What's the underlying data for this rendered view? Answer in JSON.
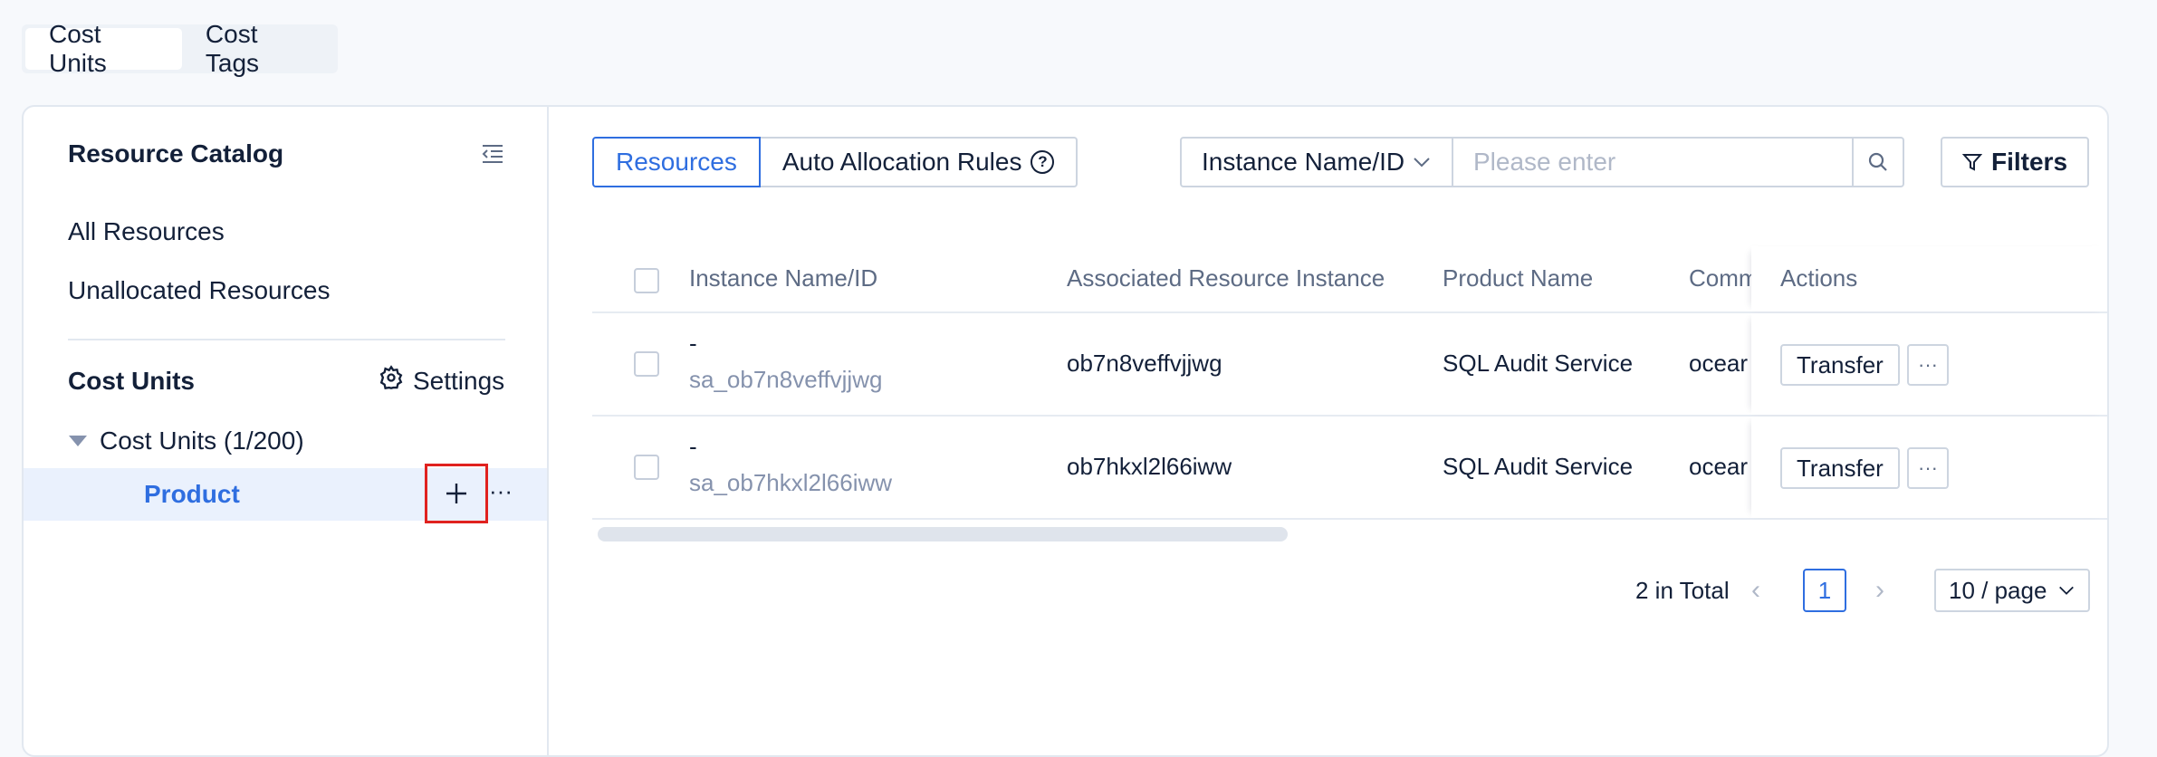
{
  "top_tabs": [
    {
      "label": "Cost Units",
      "active": true
    },
    {
      "label": "Cost Tags",
      "active": false
    }
  ],
  "sidebar": {
    "title": "Resource Catalog",
    "links": [
      "All Resources",
      "Unallocated Resources"
    ],
    "cost_units_title": "Cost Units",
    "settings_label": "Settings",
    "tree_root": "Cost Units (1/200)",
    "tree_child": "Product",
    "more_label": "···"
  },
  "main": {
    "view_tabs": [
      "Resources",
      "Auto Allocation Rules"
    ],
    "help_glyph": "?",
    "search_field": "Instance Name/ID",
    "search_placeholder": "Please enter",
    "filters_label": "Filters",
    "columns": [
      "Instance Name/ID",
      "Associated Resource Instance",
      "Product Name",
      "Comm",
      "Actions"
    ],
    "rows": [
      {
        "dash": "-",
        "instance_id": "sa_ob7n8veffvjjwg",
        "associated": "ob7n8veffvjjwg",
        "product": "SQL Audit Service",
        "comm": "ocear"
      },
      {
        "dash": "-",
        "instance_id": "sa_ob7hkxl2l66iww",
        "associated": "ob7hkxl2l66iww",
        "product": "SQL Audit Service",
        "comm": "ocear"
      }
    ],
    "transfer_label": "Transfer",
    "row_more_label": "···",
    "total_label": "2 in Total",
    "prev_glyph": "‹",
    "next_glyph": "›",
    "current_page": "1",
    "page_size": "10 / page"
  },
  "colors": {
    "accent": "#2f6ee0",
    "highlight_border": "#e0221f",
    "selected_row": "#eaf1fd"
  }
}
